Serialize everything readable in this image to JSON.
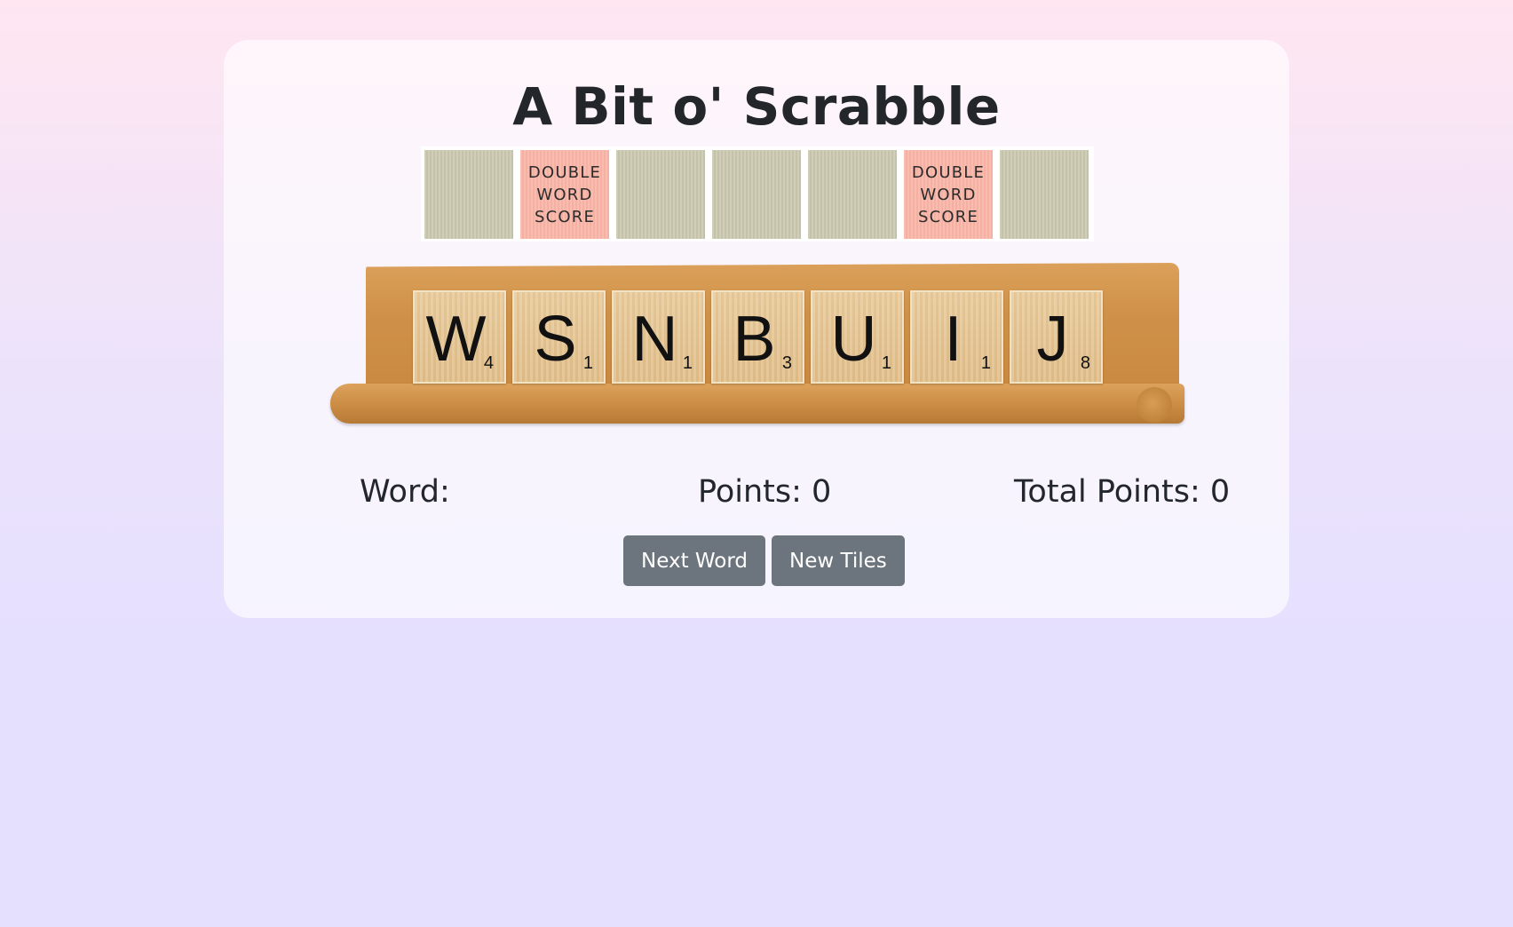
{
  "title": "A Bit o' Scrabble",
  "board": {
    "squares": [
      {
        "type": "plain",
        "label": ""
      },
      {
        "type": "double-word",
        "label": "DOUBLE\nWORD\nSCORE"
      },
      {
        "type": "plain",
        "label": ""
      },
      {
        "type": "plain",
        "label": ""
      },
      {
        "type": "plain",
        "label": ""
      },
      {
        "type": "double-word",
        "label": "DOUBLE\nWORD\nSCORE"
      },
      {
        "type": "plain",
        "label": ""
      }
    ]
  },
  "rack": {
    "tiles": [
      {
        "letter": "W",
        "value": "4"
      },
      {
        "letter": "S",
        "value": "1"
      },
      {
        "letter": "N",
        "value": "1"
      },
      {
        "letter": "B",
        "value": "3"
      },
      {
        "letter": "U",
        "value": "1"
      },
      {
        "letter": "I",
        "value": "1"
      },
      {
        "letter": "J",
        "value": "8"
      }
    ]
  },
  "stats": {
    "word": "Word:",
    "points": "Points: 0",
    "total_points": "Total Points: 0"
  },
  "buttons": {
    "next_word": "Next Word",
    "new_tiles": "New Tiles"
  },
  "colors": {
    "button_bg": "#6c757d",
    "double_word_square": "#f9b4a6",
    "plain_square": "#cbc8b0",
    "tile": "#dfbe8b",
    "rack": "#cf9149"
  }
}
